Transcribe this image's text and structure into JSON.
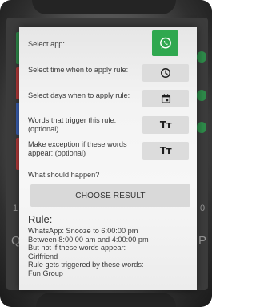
{
  "background_app": {
    "number_left": "1",
    "number_right": "0",
    "letter_left": "Q",
    "letter_right": "P"
  },
  "dialog": {
    "select_app_label": "Select app:",
    "select_time_label": "Select time when to apply rule:",
    "select_days_label": "Select days when to apply rule:",
    "trigger_words_label": "Words that trigger this rule: (optional)",
    "exception_words_label": "Make exception if these words appear: (optional)",
    "what_happens_label": "What should happen?",
    "choose_result_button": "CHOOSE RESULT",
    "text_format_icon_text": "Tт"
  },
  "rule": {
    "title": "Rule:",
    "lines": [
      "WhatsApp: Snooze to 6:00:00 pm",
      "Between 8:00:00 am and 4:00:00 pm",
      "But not if these words appear:",
      "Girlfriend",
      "Rule gets triggered by these words:",
      "Fun Group"
    ]
  },
  "colors": {
    "whatsapp_green": "#2fa84f",
    "button_gray": "#dcdcdc",
    "dialog_bg": "#f4f4f4"
  }
}
